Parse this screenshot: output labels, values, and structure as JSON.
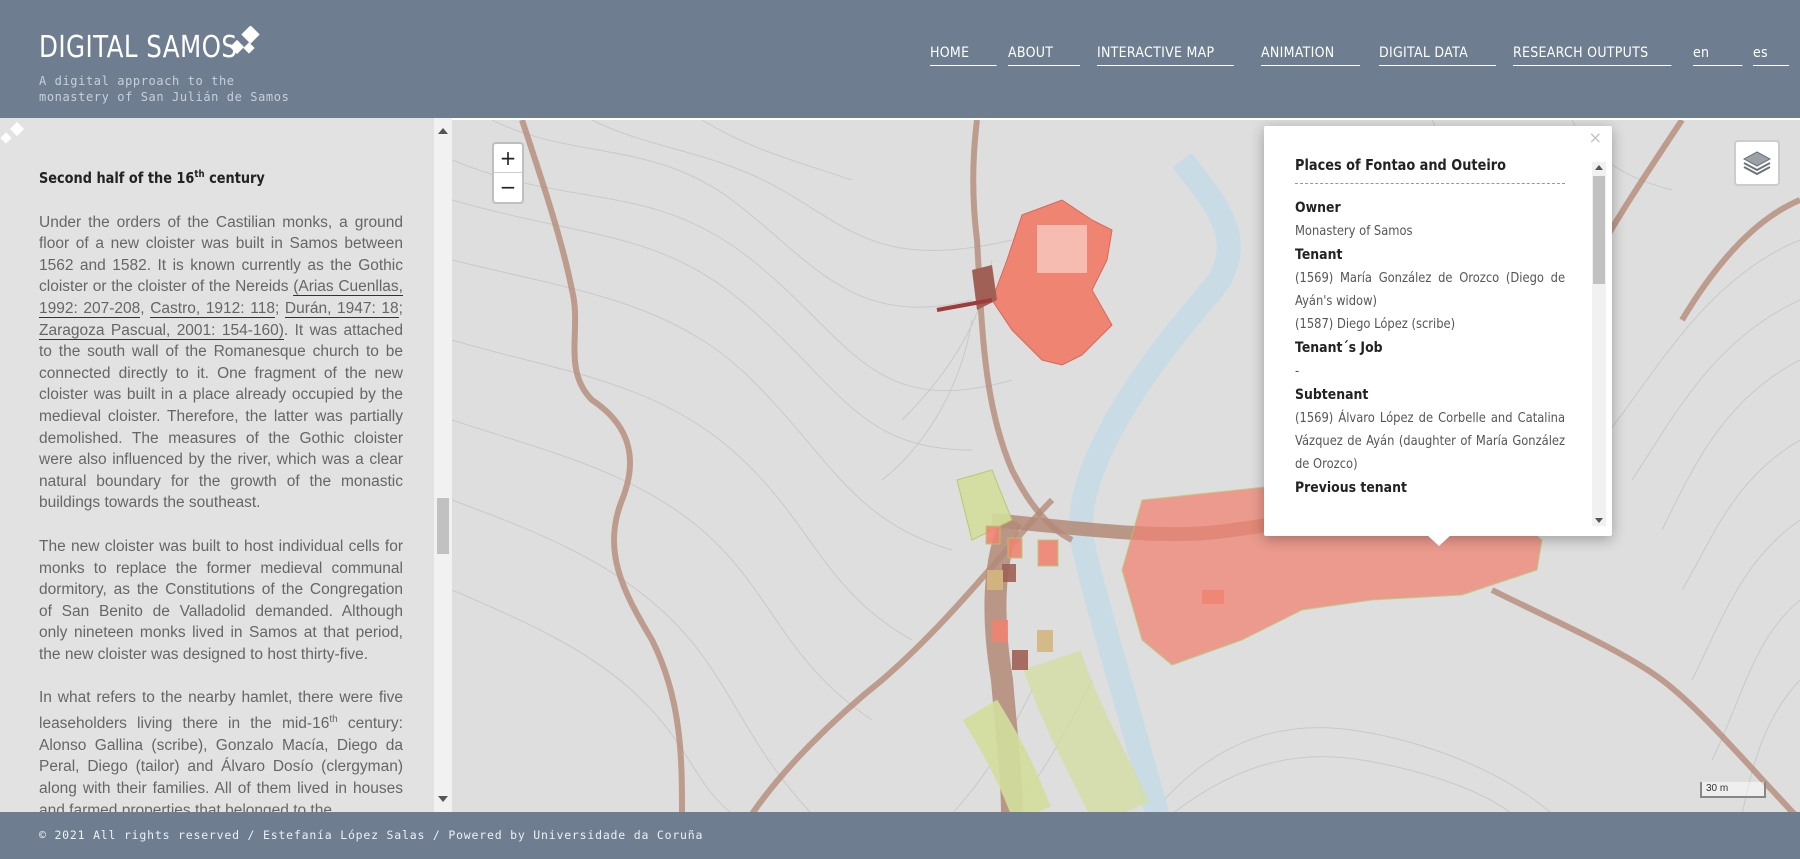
{
  "header": {
    "title": "DIGITAL SAMOS",
    "subtitle_line1": "A digital approach to the",
    "subtitle_line2": "monastery of San Julián de Samos",
    "nav": {
      "home": "HOME",
      "about": "ABOUT",
      "interactive_map": "INTERACTIVE MAP",
      "animation": "ANIMATION",
      "digital_data": "DIGITAL DATA",
      "research_outputs": "RESEARCH OUTPUTS",
      "lang_en": "en",
      "lang_es": "es"
    }
  },
  "sidebar": {
    "heading_main": "Second half of the 16",
    "heading_sup": "th",
    "heading_tail": " century",
    "p1_text": "Under the orders of the Castilian monks, a ground floor of a new cloister was built in Samos between 1562 and 1582. It is known currently as the Gothic cloister or the cloister of the Nereids ",
    "p1_ref1": "(Arias Cuenllas, 1992: 207-208",
    "p1_sep1": ", ",
    "p1_ref2": "Castro, 1912: 118",
    "p1_sep2": "; ",
    "p1_ref3": "Durán, 1947: 18",
    "p1_sep3": "; ",
    "p1_ref4": "Zaragoza Pascual, 2001: 154-160)",
    "p1_tail": ". It was attached to the south wall of the Romanesque church to be connected directly to it. One fragment of the new cloister was built in a place already occupied by the medieval cloister. Therefore, the latter was partially demolished. The measures of the Gothic cloister were also influenced by the river, which was a clear natural boundary for the growth of the monastic buildings towards the southeast.",
    "p2": "The new cloister was built to host individual cells for monks to replace the former medieval communal dormitory, as the Constitutions of the Congregation of San Benito de Valladolid demanded. Although only nineteen monks lived in Samos at that period, the new cloister was designed to host thirty-five.",
    "p3_a": "In what refers to the nearby hamlet, there were five leaseholders living there in the mid-16",
    "p3_sup": "th",
    "p3_b": " century: Alonso Gallina (scribe), Gonzalo Macía, Diego da Peral, Diego (tailor) and Álvaro Dosío (clergyman) along with their families. All of them lived in houses and farmed properties that belonged to the"
  },
  "map": {
    "zoom_in": "+",
    "zoom_out": "−",
    "scale_label": "30 m",
    "colors": {
      "background": "#dedede",
      "road": "#b48a78",
      "river": "#c6dbe6",
      "monastery_property": "#f08473",
      "tenant_property": "#d3de9c",
      "popup_bg": "#ffffff"
    }
  },
  "popup": {
    "close": "×",
    "title": "Places of Fontao and Outeiro",
    "owner_label": "Owner",
    "owner_value": "Monastery of Samos",
    "tenant_label": "Tenant",
    "tenant_value_1": "(1569) María González de Orozco (Diego de Ayán's widow)",
    "tenant_value_2": "(1587) Diego López (scribe)",
    "tenant_job_label": "Tenant´s Job",
    "tenant_job_value": "-",
    "subtenant_label": "Subtenant",
    "subtenant_value": "(1569) Álvaro López de Corbelle and Catalina Vázquez de Ayán (daughter of María González de Orozco)",
    "previous_tenant_label": "Previous tenant"
  },
  "footer": {
    "text": "© 2021 All rights reserved / Estefanía López Salas / Powered by Universidade da Coruña"
  }
}
